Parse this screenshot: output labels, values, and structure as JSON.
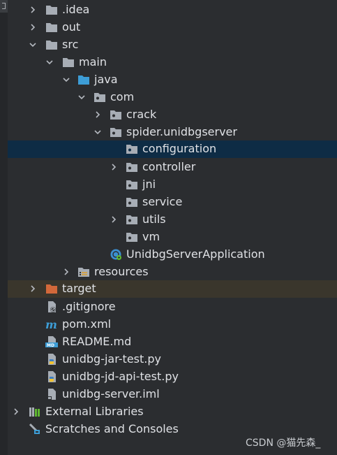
{
  "tree": {
    "items": [
      {
        "label": ".idea",
        "icon": "folder-icon"
      },
      {
        "label": "out",
        "icon": "folder-icon"
      },
      {
        "label": "src",
        "icon": "folder-icon"
      },
      {
        "label": "main",
        "icon": "folder-icon"
      },
      {
        "label": "java",
        "icon": "source-folder-icon"
      },
      {
        "label": "com",
        "icon": "package-icon"
      },
      {
        "label": "crack",
        "icon": "package-icon"
      },
      {
        "label": "spider.unidbgserver",
        "icon": "package-icon"
      },
      {
        "label": "configuration",
        "icon": "package-icon"
      },
      {
        "label": "controller",
        "icon": "package-icon"
      },
      {
        "label": "jni",
        "icon": "package-icon"
      },
      {
        "label": "service",
        "icon": "package-icon"
      },
      {
        "label": "utils",
        "icon": "package-icon"
      },
      {
        "label": "vm",
        "icon": "package-icon"
      },
      {
        "label": "UnidbgServerApplication",
        "icon": "spring-boot-class-icon"
      },
      {
        "label": "resources",
        "icon": "resources-folder-icon"
      },
      {
        "label": "target",
        "icon": "excluded-folder-icon"
      },
      {
        "label": ".gitignore",
        "icon": "ignored-file-icon"
      },
      {
        "label": "pom.xml",
        "icon": "maven-icon"
      },
      {
        "label": "README.md",
        "icon": "markdown-icon"
      },
      {
        "label": "unidbg-jar-test.py",
        "icon": "python-file-icon"
      },
      {
        "label": "unidbg-jd-api-test.py",
        "icon": "python-file-icon"
      },
      {
        "label": "unidbg-server.iml",
        "icon": "module-file-icon"
      },
      {
        "label": "External Libraries",
        "icon": "library-icon"
      },
      {
        "label": "Scratches and Consoles",
        "icon": "scratches-icon"
      }
    ]
  },
  "watermark": "CSDN @猫先森_",
  "colors": {
    "background": "#2b2d30",
    "selected_row": "#0e2c45",
    "highlight_row": "#3a362c",
    "folder": "#a7adb5",
    "source_folder": "#3d9dd6",
    "excluded_folder": "#d2683a"
  }
}
